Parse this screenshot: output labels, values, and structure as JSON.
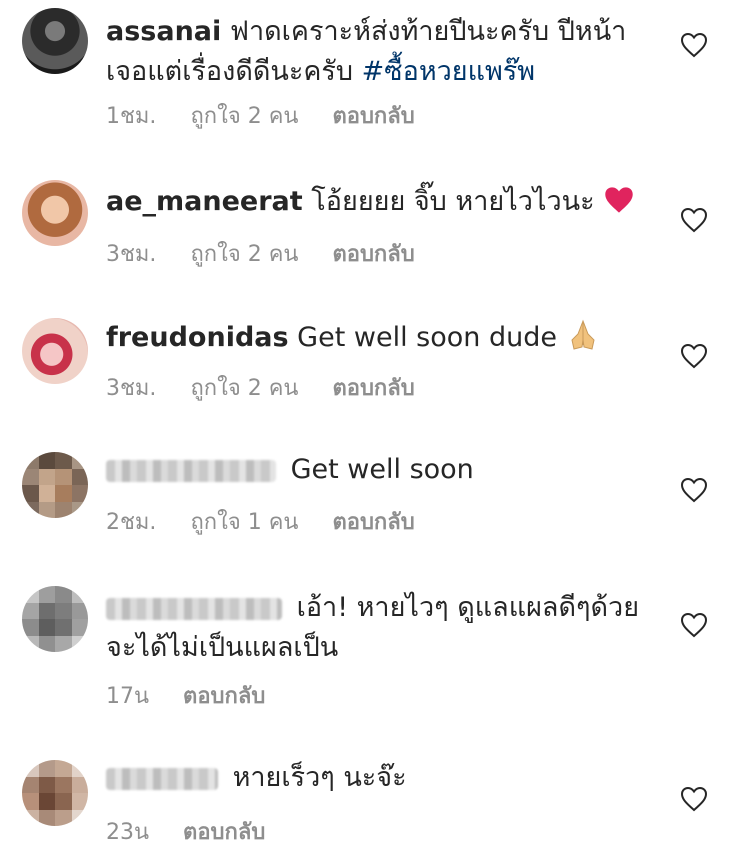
{
  "colors": {
    "text": "#262626",
    "muted": "#8e8e8e",
    "hashtag": "#003569",
    "heart_emoji": "#e0245e"
  },
  "comments": [
    {
      "username": "assanai",
      "text": "ฟาดเคราะห์ส่งท้ายปีนะครับ ปีหน้าเจอแต่เรื่องดีดีนะครับ",
      "hashtag": "#ซื้อหวยแพร๊พ",
      "time": "1ชม.",
      "likes": "ถูกใจ 2 คน",
      "reply": "ตอบกลับ"
    },
    {
      "username": "ae_maneerat",
      "text": "โอ้ยยยย จิ๊บ หายไวไวนะ",
      "emoji": "red-heart",
      "time": "3ชม.",
      "likes": "ถูกใจ 2 คน",
      "reply": "ตอบกลับ"
    },
    {
      "username": "freudonidas",
      "text": "Get well soon dude",
      "emoji": "folded-hands",
      "time": "3ชม.",
      "likes": "ถูกใจ 2 คน",
      "reply": "ตอบกลับ"
    },
    {
      "username": "",
      "text": "Get well soon",
      "time": "2ชม.",
      "likes": "ถูกใจ 1 คน",
      "reply": "ตอบกลับ"
    },
    {
      "username": "",
      "text": "เอ้า! หายไวๆ ดูแลแผลดีๆด้วย จะได้ไม่เป็นแผลเป็น",
      "time": "17น",
      "reply": "ตอบกลับ"
    },
    {
      "username": "",
      "text": "หายเร็วๆ นะจ๊ะ",
      "time": "23น",
      "reply": "ตอบกลับ"
    }
  ]
}
